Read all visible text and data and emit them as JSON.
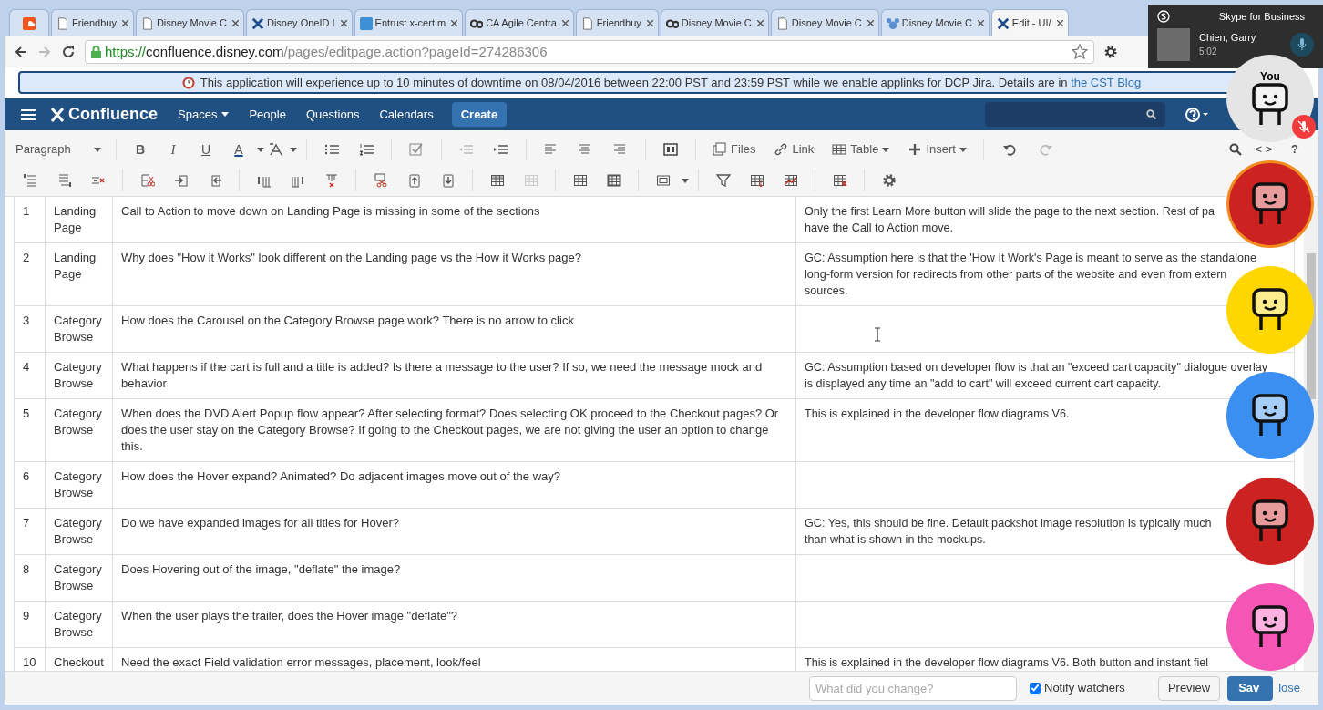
{
  "browser": {
    "tabs": [
      {
        "kind": "soundcloud",
        "selected": false
      },
      {
        "kind": "page",
        "title": "Friendbuy",
        "selected": false
      },
      {
        "kind": "page",
        "title": "Disney Movie C",
        "selected": false
      },
      {
        "kind": "confluence",
        "title": "Disney OneID I",
        "selected": false
      },
      {
        "kind": "letter-b",
        "title": "Entrust x-cert m",
        "selected": false
      },
      {
        "kind": "ca",
        "title": "CA Agile Centra",
        "selected": false
      },
      {
        "kind": "page",
        "title": "Friendbuy",
        "selected": false
      },
      {
        "kind": "ca",
        "title": "Disney Movie C",
        "selected": false
      },
      {
        "kind": "page",
        "title": "Disney Movie C",
        "selected": false
      },
      {
        "kind": "mouse",
        "title": "Disney Movie C",
        "selected": false
      },
      {
        "kind": "confluence",
        "title": "Edit - UI/",
        "selected": true
      }
    ],
    "url": {
      "scheme": "https://",
      "host": "confluence.disney.com",
      "path": "/pages/editpage.action?pageId=274286306"
    }
  },
  "banner": {
    "text": "This application will experience up to 10 minutes of downtime on 08/04/2016 between 22:00 PST and 23:59 PST while we enable applinks for DCP Jira. Details are in",
    "link": "the CST Blog"
  },
  "nav": {
    "logo": "Confluence",
    "items": [
      {
        "label": "Spaces",
        "dropdown": true
      },
      {
        "label": "People",
        "dropdown": false
      },
      {
        "label": "Questions",
        "dropdown": false
      },
      {
        "label": "Calendars",
        "dropdown": false
      }
    ],
    "create": "Create"
  },
  "toolbar": {
    "format": "Paragraph",
    "styles": [
      "B",
      "I",
      "U",
      "A"
    ],
    "text_buttons": [
      {
        "label": "Files",
        "dropdown": false
      },
      {
        "label": "Link",
        "dropdown": false
      },
      {
        "label": "Table",
        "dropdown": true
      },
      {
        "label": "Insert",
        "dropdown": true
      }
    ],
    "source": "< >",
    "help": "?"
  },
  "table": {
    "rows": [
      {
        "num": "1",
        "section": "Landing Page",
        "question": "Call to Action to move down on  Landing Page is missing in some of the sections",
        "answer": "Only the first Learn More button will slide the page to the next section. Rest of pa\nhave the Call to Action move."
      },
      {
        "num": "2",
        "section": "Landing Page",
        "question": "Why does \"How it Works\" look different on the Landing page vs the How it Works page?",
        "answer": "GC: Assumption here is that the 'How It Work's Page is meant to serve as the standalone\nlong-form version for redirects from other parts of the website and even from extern\nsources."
      },
      {
        "num": "3",
        "section": "Category Browse",
        "question": "How does the Carousel on the Category Browse page work? There is no arrow to click"
      },
      {
        "num": "4",
        "section": "Category Browse",
        "question": "What happens if the cart is full and a title is added? Is there a message to the user? If so, we need the message mock and behavior",
        "answer": "GC: Assumption based on developer flow is that an \"exceed cart capacity\" dialogue overlay\nis displayed any time an \"add to cart\" will exceed current cart capacity."
      },
      {
        "num": "5",
        "section": "Category Browse",
        "question": "When does the DVD Alert Popup flow appear? After selecting format? Does selecting OK proceed to the Checkout pages? Or does the user stay on the Category Browse? If going to the Checkout pages, we are not giving the user an option to change this.",
        "answer": "This is explained in the developer flow diagrams V6."
      },
      {
        "num": "6",
        "section": "Category Browse",
        "question": "How does the Hover expand? Animated?  Do adjacent images move out of the way?"
      },
      {
        "num": "7",
        "section": "Category Browse",
        "question": "Do we have expanded images for all titles for Hover?",
        "answer": "GC: Yes, this should be fine. Default packshot image resolution is typically much\nthan what is shown in the mockups."
      },
      {
        "num": "8",
        "section": "Category Browse",
        "question": "Does Hovering out of the image, \"deflate\" the image?"
      },
      {
        "num": "9",
        "section": "Category Browse",
        "question": "When the user plays the trailer, does the Hover image \"deflate\"?"
      },
      {
        "num": "10",
        "section": "Checkout",
        "question": "Need the exact Field validation error messages, placement, look/feel",
        "answer": "This is explained in the developer flow diagrams V6. Both button and instant fiel"
      }
    ]
  },
  "footer": {
    "comment_placeholder": "What did you change?",
    "notify": {
      "label": "Notify watchers",
      "checked": true
    },
    "preview": "Preview",
    "save": "Sav",
    "close": "lose"
  },
  "skype": {
    "app": "Skype for Business",
    "caller": "Chien, Garry",
    "duration": "5:02",
    "participants": [
      {
        "label": "You",
        "color": "#e5e5e5",
        "muted": true,
        "speaking": false
      },
      {
        "color": "#cc2222",
        "muted": false,
        "speaking": true
      },
      {
        "color": "#ffd600",
        "muted": false,
        "speaking": false
      },
      {
        "color": "#3b8ff0",
        "muted": false,
        "speaking": false
      },
      {
        "color": "#cc2222",
        "muted": false,
        "speaking": false
      },
      {
        "color": "#f556b5",
        "muted": false,
        "speaking": false
      }
    ]
  }
}
